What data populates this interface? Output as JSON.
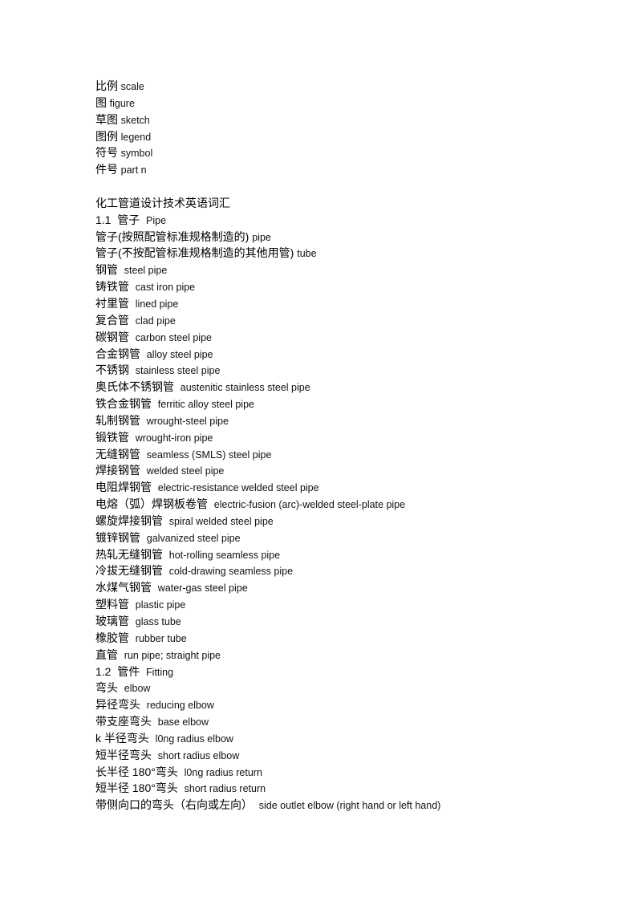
{
  "block1": [
    {
      "zh": "比例",
      "en": "scale"
    },
    {
      "zh": "图",
      "en": "figure"
    },
    {
      "zh": "草图",
      "en": "sketch"
    },
    {
      "zh": "图例",
      "en": "legend"
    },
    {
      "zh": "符号",
      "en": "symbol"
    },
    {
      "zh": "件号",
      "en": "part n"
    }
  ],
  "block2": [
    {
      "zh": "化工管道设计技术英语词汇",
      "en": ""
    },
    {
      "zh": "1.1  管子  ",
      "en": "Pipe"
    },
    {
      "zh": "管子(按照配管标准规格制造的) ",
      "en": "pipe"
    },
    {
      "zh": "管子(不按配管标准规格制造的其他用管) ",
      "en": "tube"
    },
    {
      "zh": "钢管  ",
      "en": "steel pipe"
    },
    {
      "zh": "铸铁管  ",
      "en": "cast iron pipe"
    },
    {
      "zh": "衬里管  ",
      "en": "lined pipe"
    },
    {
      "zh": "复合管  ",
      "en": "clad pipe"
    },
    {
      "zh": "碳钢管  ",
      "en": "carbon steel pipe"
    },
    {
      "zh": "合金钢管  ",
      "en": "alloy steel pipe"
    },
    {
      "zh": "不锈钢  ",
      "en": "stainless steel pipe"
    },
    {
      "zh": "奥氏体不锈钢管  ",
      "en": "austenitic stainless steel pipe"
    },
    {
      "zh": "铁合金钢管  ",
      "en": "ferritic alloy steel pipe"
    },
    {
      "zh": "轧制钢管  ",
      "en": "wrought-steel pipe"
    },
    {
      "zh": "锻铁管  ",
      "en": "wrought-iron pipe"
    },
    {
      "zh": "无缝钢管  ",
      "en": "seamless (SMLS) steel pipe"
    },
    {
      "zh": "焊接钢管  ",
      "en": "welded steel pipe"
    },
    {
      "zh": "电阻焊钢管  ",
      "en": "electric-resistance welded steel pipe"
    },
    {
      "zh": "电熔（弧）焊钢板卷管  ",
      "en": "electric-fusion (arc)-welded steel-plate pipe"
    },
    {
      "zh": "螺旋焊接钢管  ",
      "en": "spiral welded steel pipe"
    },
    {
      "zh": "镀锌钢管  ",
      "en": "galvanized steel pipe"
    },
    {
      "zh": "热轧无缝钢管  ",
      "en": "hot-rolling seamless pipe"
    },
    {
      "zh": "冷拔无缝钢管  ",
      "en": "cold-drawing seamless pipe"
    },
    {
      "zh": "水煤气钢管  ",
      "en": "water-gas steel pipe"
    },
    {
      "zh": "塑料管  ",
      "en": "plastic pipe"
    },
    {
      "zh": "玻璃管  ",
      "en": "glass tube"
    },
    {
      "zh": "橡胶管  ",
      "en": "rubber tube"
    },
    {
      "zh": "直管  ",
      "en": "run pipe; straight pipe"
    },
    {
      "zh": "1.2  管件  ",
      "en": "Fitting"
    },
    {
      "zh": "弯头  ",
      "en": "elbow"
    },
    {
      "zh": "异径弯头  ",
      "en": "reducing elbow"
    },
    {
      "zh": "带支座弯头  ",
      "en": "base elbow"
    },
    {
      "zh": "k 半径弯头  ",
      "en": "l0ng radius elbow"
    },
    {
      "zh": "短半径弯头  ",
      "en": "short radius elbow"
    },
    {
      "zh": "长半径 180°弯头  ",
      "en": "l0ng radius return"
    },
    {
      "zh": "短半径 180°弯头  ",
      "en": "short radius return"
    },
    {
      "zh": "带侧向口的弯头（右向或左向）  ",
      "en": "side outlet elbow (right hand or left hand)"
    }
  ]
}
